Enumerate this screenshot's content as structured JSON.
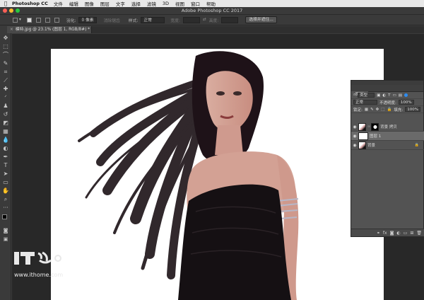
{
  "menubar": {
    "app_name": "Photoshop CC",
    "items": [
      "文件",
      "编辑",
      "图像",
      "图层",
      "文字",
      "选择",
      "滤镜",
      "3D",
      "视图",
      "窗口",
      "帮助"
    ]
  },
  "window": {
    "title": "Adobe Photoshop CC 2017"
  },
  "options": {
    "feather_label": "羽化:",
    "feather_value": "0 像素",
    "antialias_label": "消除锯齿",
    "style_label": "样式:",
    "style_value": "正常",
    "width_label": "宽度:",
    "height_label": "高度:",
    "select_mask_button": "选择并遮住..."
  },
  "document_tab": {
    "title": "模特.jpg @ 23.1% (图层 1, RGB/8#) *",
    "close_icon": "×"
  },
  "layers_panel": {
    "tab_label": "图层",
    "filter_kind": "类型",
    "blend_mode": "正常",
    "opacity_label": "不透明度:",
    "opacity_value": "100%",
    "lock_label": "锁定:",
    "fill_label": "填充:",
    "fill_value": "100%",
    "layers": [
      {
        "name": "背景 拷贝",
        "visible": true
      },
      {
        "name": "图层 1",
        "visible": true
      },
      {
        "name": "背景",
        "visible": true
      }
    ]
  },
  "watermark": {
    "text": "www.ithome.com"
  },
  "colors": {
    "accent": "#2d8cf0",
    "panel": "#535353",
    "canvas_bg": "#282828"
  }
}
